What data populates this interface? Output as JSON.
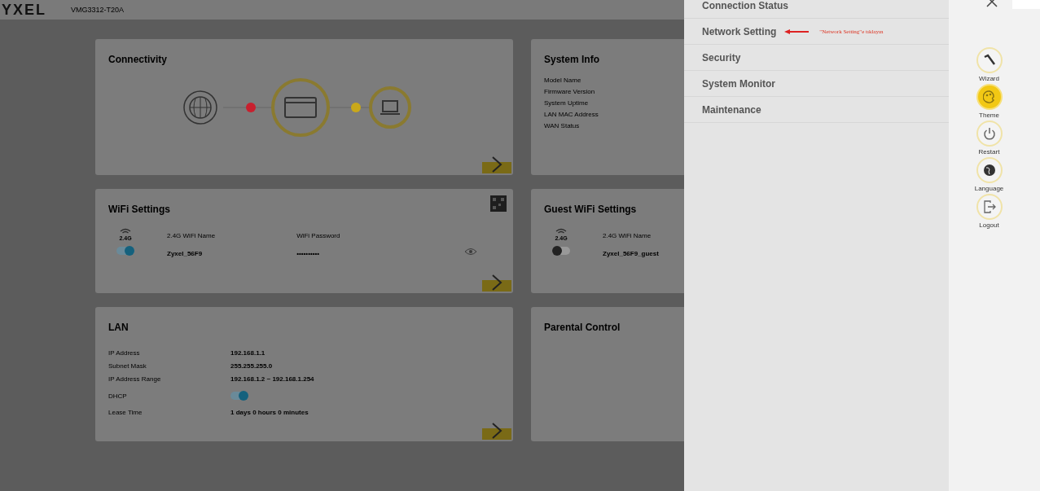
{
  "header": {
    "logo": "YXEL",
    "model": "VMG3312-T20A"
  },
  "connectivity": {
    "title": "Connectivity",
    "links": [
      {
        "color": "#c8202e"
      },
      {
        "color": "#c9a81a"
      }
    ]
  },
  "system_info": {
    "title": "System Info",
    "labels": [
      "Model Name",
      "Firmware Version",
      "System Uptime",
      "LAN MAC Address",
      "WAN Status"
    ]
  },
  "wifi": {
    "title": "WiFi Settings",
    "band": "2.4G",
    "name_label": "2.4G WiFi Name",
    "password_label": "WiFi Password",
    "name": "Zyxel_56F9",
    "password": "••••••••••",
    "on": true
  },
  "guest_wifi": {
    "title": "Guest WiFi Settings",
    "band": "2.4G",
    "name_label": "2.4G WiFi Name",
    "name": "Zyxel_56F9_guest",
    "on": false
  },
  "lan": {
    "title": "LAN",
    "rows": [
      {
        "kind": "text",
        "label": "IP Address",
        "value": "192.168.1.1"
      },
      {
        "kind": "text",
        "label": "Subnet Mask",
        "value": "255.255.255.0"
      },
      {
        "kind": "text",
        "label": "IP Address Range",
        "value": "192.168.1.2 ~ 192.168.1.254"
      },
      {
        "kind": "toggle",
        "label": "DHCP",
        "on": true
      },
      {
        "kind": "text",
        "label": "Lease Time",
        "value": "1 days 0 hours 0 minutes"
      }
    ]
  },
  "parental": {
    "title": "Parental Control"
  },
  "menu": {
    "items": [
      {
        "label": "Connection Status",
        "selected": false
      },
      {
        "label": "Network Setting",
        "selected": false
      },
      {
        "label": "Security",
        "selected": false
      },
      {
        "label": "System Monitor",
        "selected": false
      },
      {
        "label": "Maintenance",
        "selected": false
      }
    ],
    "annotation": "\"Network Setting\"e tıklayın"
  },
  "rail": {
    "items": [
      {
        "kind": "wizard",
        "label": "Wizard",
        "selected": false
      },
      {
        "kind": "theme",
        "label": "Theme",
        "selected": true
      },
      {
        "kind": "restart",
        "label": "Restart",
        "selected": false
      },
      {
        "kind": "language",
        "label": "Language",
        "selected": false
      },
      {
        "kind": "logout",
        "label": "Logout",
        "selected": false
      }
    ]
  }
}
